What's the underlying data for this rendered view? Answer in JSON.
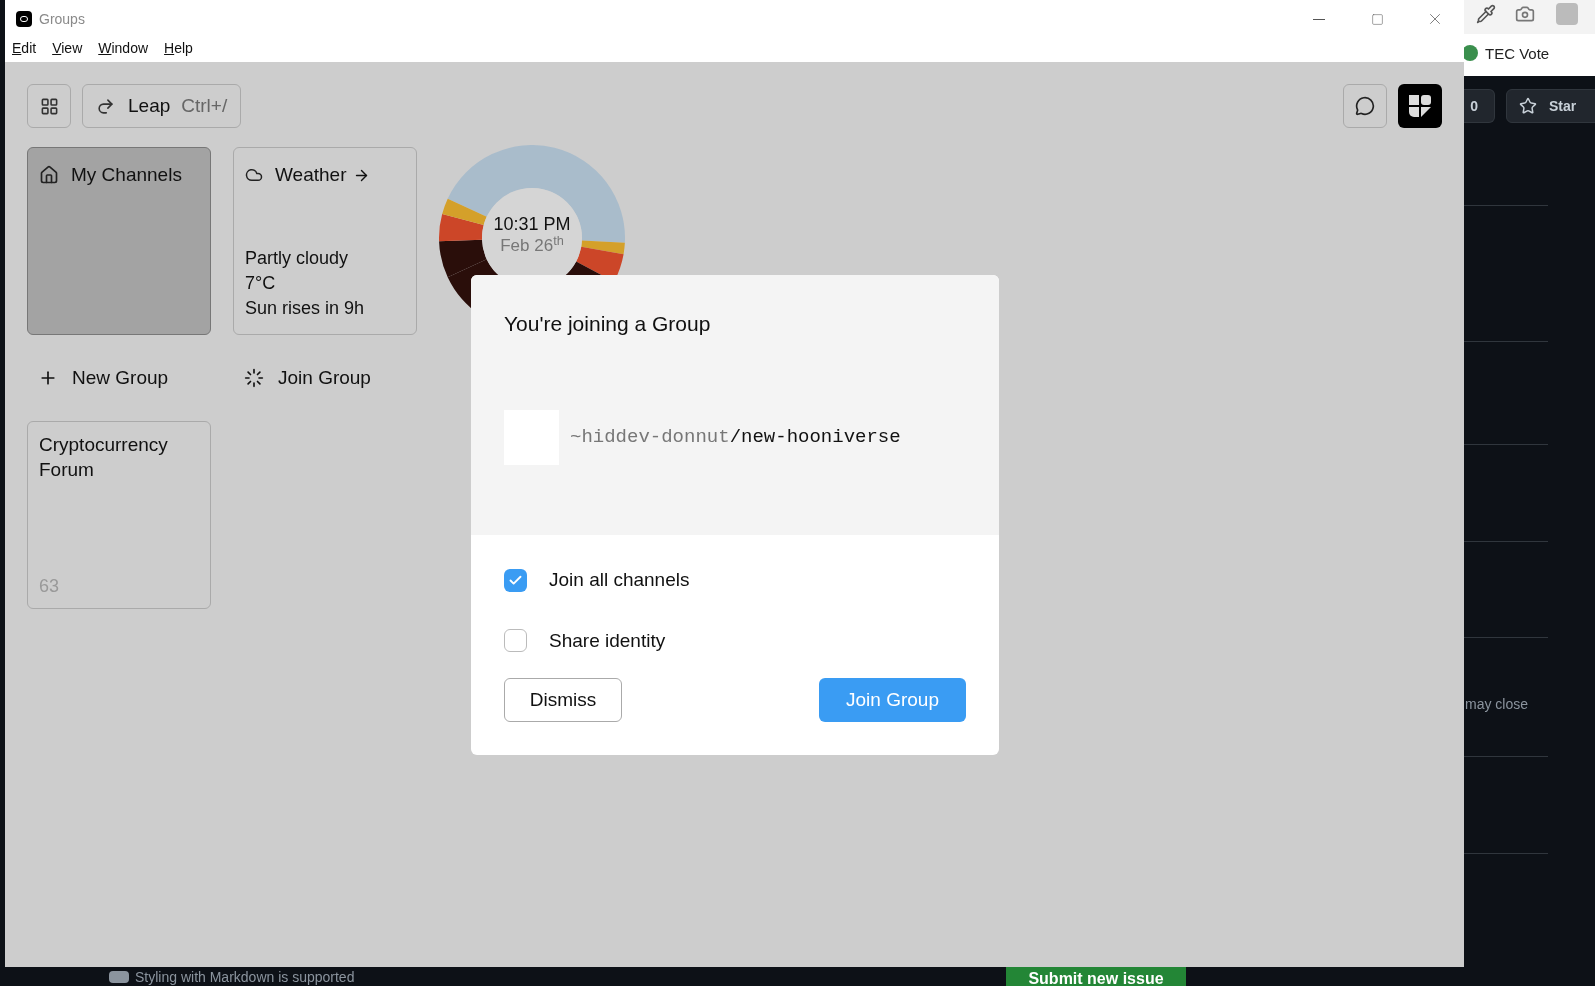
{
  "window": {
    "title": "Groups",
    "menu": [
      "Edit",
      "View",
      "Window",
      "Help"
    ]
  },
  "toolbar": {
    "leap": "Leap",
    "shortcut": "Ctrl+/"
  },
  "tiles": [
    {
      "kind": "channels",
      "title": "My Channels",
      "selected": true
    },
    {
      "kind": "weather",
      "title": "Weather",
      "selected": false,
      "lines": [
        "Partly cloudy",
        "7°C",
        "Sun rises in 9h"
      ]
    }
  ],
  "clock": {
    "time": "10:31 PM",
    "date": "Feb 26$^{th}$"
  },
  "actions": [
    {
      "kind": "new",
      "label": "New Group"
    },
    {
      "kind": "join",
      "label": "Join Group"
    }
  ],
  "groups": [
    {
      "title": "Cryptocurrency Forum",
      "count": "63"
    }
  ],
  "dialog": {
    "title": "You're joining a Group",
    "ship": "~hiddev-donnut",
    "group": "/new-hooniverse",
    "options": [
      {
        "label": "Join all channels",
        "checked": true
      },
      {
        "label": "Share identity",
        "checked": false
      }
    ],
    "dismiss": "Dismiss",
    "join": "Join Group"
  },
  "background": {
    "bookmark": "TEC Vote",
    "star_count": "0",
    "star": "Star",
    "snippet": "may close",
    "markdown_hint": "Styling with Markdown is supported",
    "submit": "Submit new issue"
  }
}
